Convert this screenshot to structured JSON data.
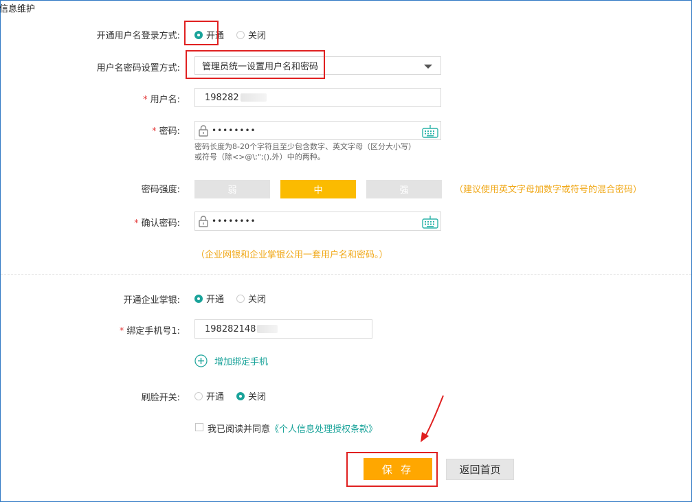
{
  "section_title": "信息维护",
  "login_mode": {
    "label": "开通用户名登录方式:",
    "options": [
      {
        "label": "开通",
        "selected": true
      },
      {
        "label": "关闭",
        "selected": false
      }
    ]
  },
  "pwd_setting": {
    "label": "用户名密码设置方式:",
    "selected_value": "管理员统一设置用户名和密码"
  },
  "username": {
    "label": "用户名:",
    "value": "198282"
  },
  "password": {
    "label": "密码:",
    "masked_value": "••••••••",
    "hint_line1": "密码长度为8-20个字符且至少包含数字、英文字母（区分大小写）",
    "hint_line2": "或符号（除<>@\\;\";(),外）中的两种。"
  },
  "strength": {
    "label": "密码强度:",
    "levels": [
      "弱",
      "中",
      "强"
    ],
    "active_index": 1,
    "note": "（建议使用英文字母加数字或符号的混合密码）"
  },
  "confirm_password": {
    "label": "确认密码:",
    "masked_value": "••••••••"
  },
  "shared_note": "（企业网银和企业掌银公用一套用户名和密码。）",
  "mobile_bank": {
    "label": "开通企业掌银:",
    "options": [
      {
        "label": "开通",
        "selected": true
      },
      {
        "label": "关闭",
        "selected": false
      }
    ]
  },
  "bind_phone": {
    "label": "绑定手机号1:",
    "value": "198282148"
  },
  "add_phone_label": "增加绑定手机",
  "face_switch": {
    "label": "刷脸开关:",
    "options": [
      {
        "label": "开通",
        "selected": false
      },
      {
        "label": "关闭",
        "selected": true
      }
    ]
  },
  "agreement": {
    "text": "我已阅读并同意",
    "link": "《个人信息处理授权条款》",
    "checked": false
  },
  "buttons": {
    "save": "保 存",
    "back": "返回首页"
  },
  "colors": {
    "accent_teal": "#1aa39a",
    "save_orange": "#ffa700",
    "strength_active": "#fbbb00",
    "required_red": "#e43c3c",
    "annotation_red": "#e02020"
  }
}
